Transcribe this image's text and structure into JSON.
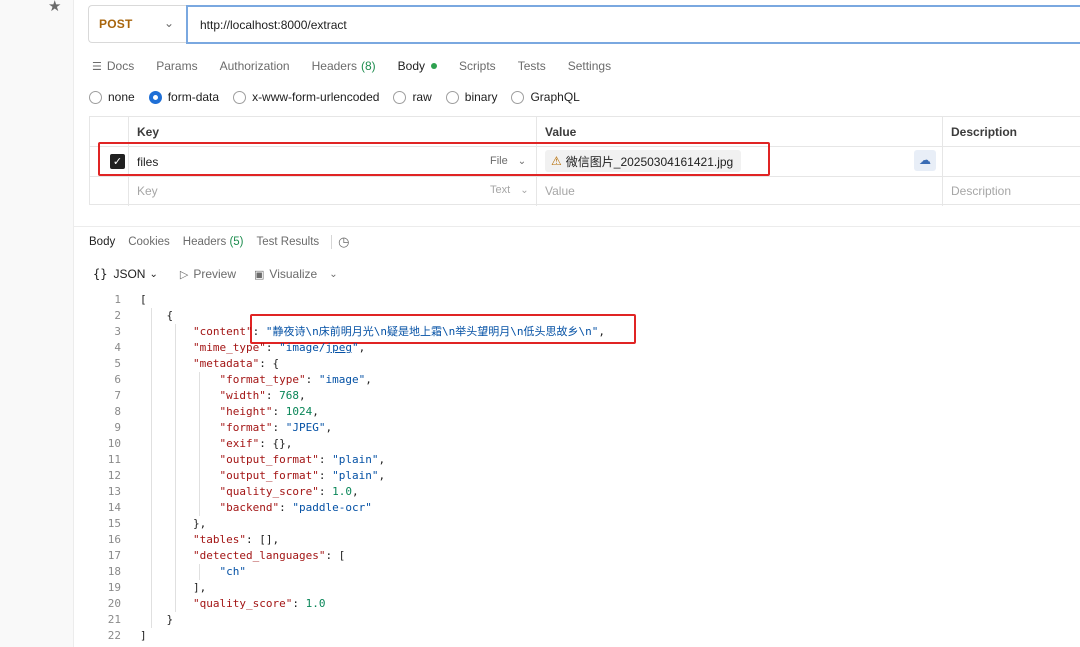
{
  "request": {
    "method": "POST",
    "url": "http://localhost:8000/extract"
  },
  "request_tabs": [
    {
      "label": "Docs"
    },
    {
      "label": "Params"
    },
    {
      "label": "Authorization"
    },
    {
      "label": "Headers",
      "count": "(8)"
    },
    {
      "label": "Body"
    },
    {
      "label": "Scripts"
    },
    {
      "label": "Tests"
    },
    {
      "label": "Settings"
    }
  ],
  "body_types": [
    "none",
    "form-data",
    "x-www-form-urlencoded",
    "raw",
    "binary",
    "GraphQL"
  ],
  "body_type_selected": "form-data",
  "form_table": {
    "headers": {
      "key": "Key",
      "value": "Value",
      "description": "Description"
    },
    "rows": [
      {
        "checked": true,
        "key": "files",
        "type": "File",
        "value": "微信图片_20250304161421.jpg",
        "value_warning": true
      }
    ],
    "placeholder": {
      "key": "Key",
      "type": "Text",
      "value": "Value",
      "description": "Description"
    }
  },
  "response_tabs": [
    {
      "label": "Body"
    },
    {
      "label": "Cookies"
    },
    {
      "label": "Headers",
      "count": "(5)"
    },
    {
      "label": "Test Results"
    }
  ],
  "response_toolbar": {
    "format": "JSON",
    "preview": "Preview",
    "visualize": "Visualize"
  },
  "response_lines": [
    "1",
    "2",
    "3",
    "4",
    "5",
    "6",
    "7",
    "8",
    "9",
    "10",
    "11",
    "12",
    "13",
    "14",
    "15",
    "16",
    "17",
    "18",
    "19",
    "20",
    "21",
    "22"
  ],
  "response_json": {
    "content_key": "\"content\"",
    "content_value": "\"静夜诗\\n床前明月光\\n疑是地上霜\\n举头望明月\\n低头思故乡\\n\"",
    "mime_type_key": "\"mime_type\"",
    "mime_type_value_a": "\"image/",
    "mime_type_value_b": "jpeg",
    "mime_type_value_c": "\"",
    "metadata_key": "\"metadata\"",
    "format_type_key": "\"format_type\"",
    "format_type_value": "\"image\"",
    "width_key": "\"width\"",
    "width_value": "768",
    "height_key": "\"height\"",
    "height_value": "1024",
    "format_key": "\"format\"",
    "format_value": "\"JPEG\"",
    "exif_key": "\"exif\"",
    "exif_value": "{}",
    "output_format_key": "\"output_format\"",
    "output_format_value": "\"plain\"",
    "output_format_key_2": "\"output_format\"",
    "output_format_value_2": "\"plain\"",
    "quality_score_key": "\"quality_score\"",
    "quality_score_value": "1.0",
    "backend_key": "\"backend\"",
    "backend_value": "\"paddle-ocr\"",
    "tables_key": "\"tables\"",
    "tables_value": "[]",
    "detected_languages_key": "\"detected_languages\"",
    "detected_languages_item": "\"ch\"",
    "quality_score_key_2": "\"quality_score\"",
    "quality_score_value_2": "1.0"
  },
  "colors": {
    "method": "#a8650c",
    "accent_blue": "#1f6fd6",
    "count_green": "#1e8d4f",
    "highlight_red": "#e02424",
    "json_key": "#a31515",
    "json_string": "#0451a5",
    "json_number": "#098658"
  },
  "icons": {
    "star": "star-icon",
    "docs": "docs-icon",
    "warning": "warning-icon",
    "upload": "cloud-upload-icon",
    "history": "history-icon",
    "preview": "play-icon",
    "visualize": "image-icon"
  }
}
